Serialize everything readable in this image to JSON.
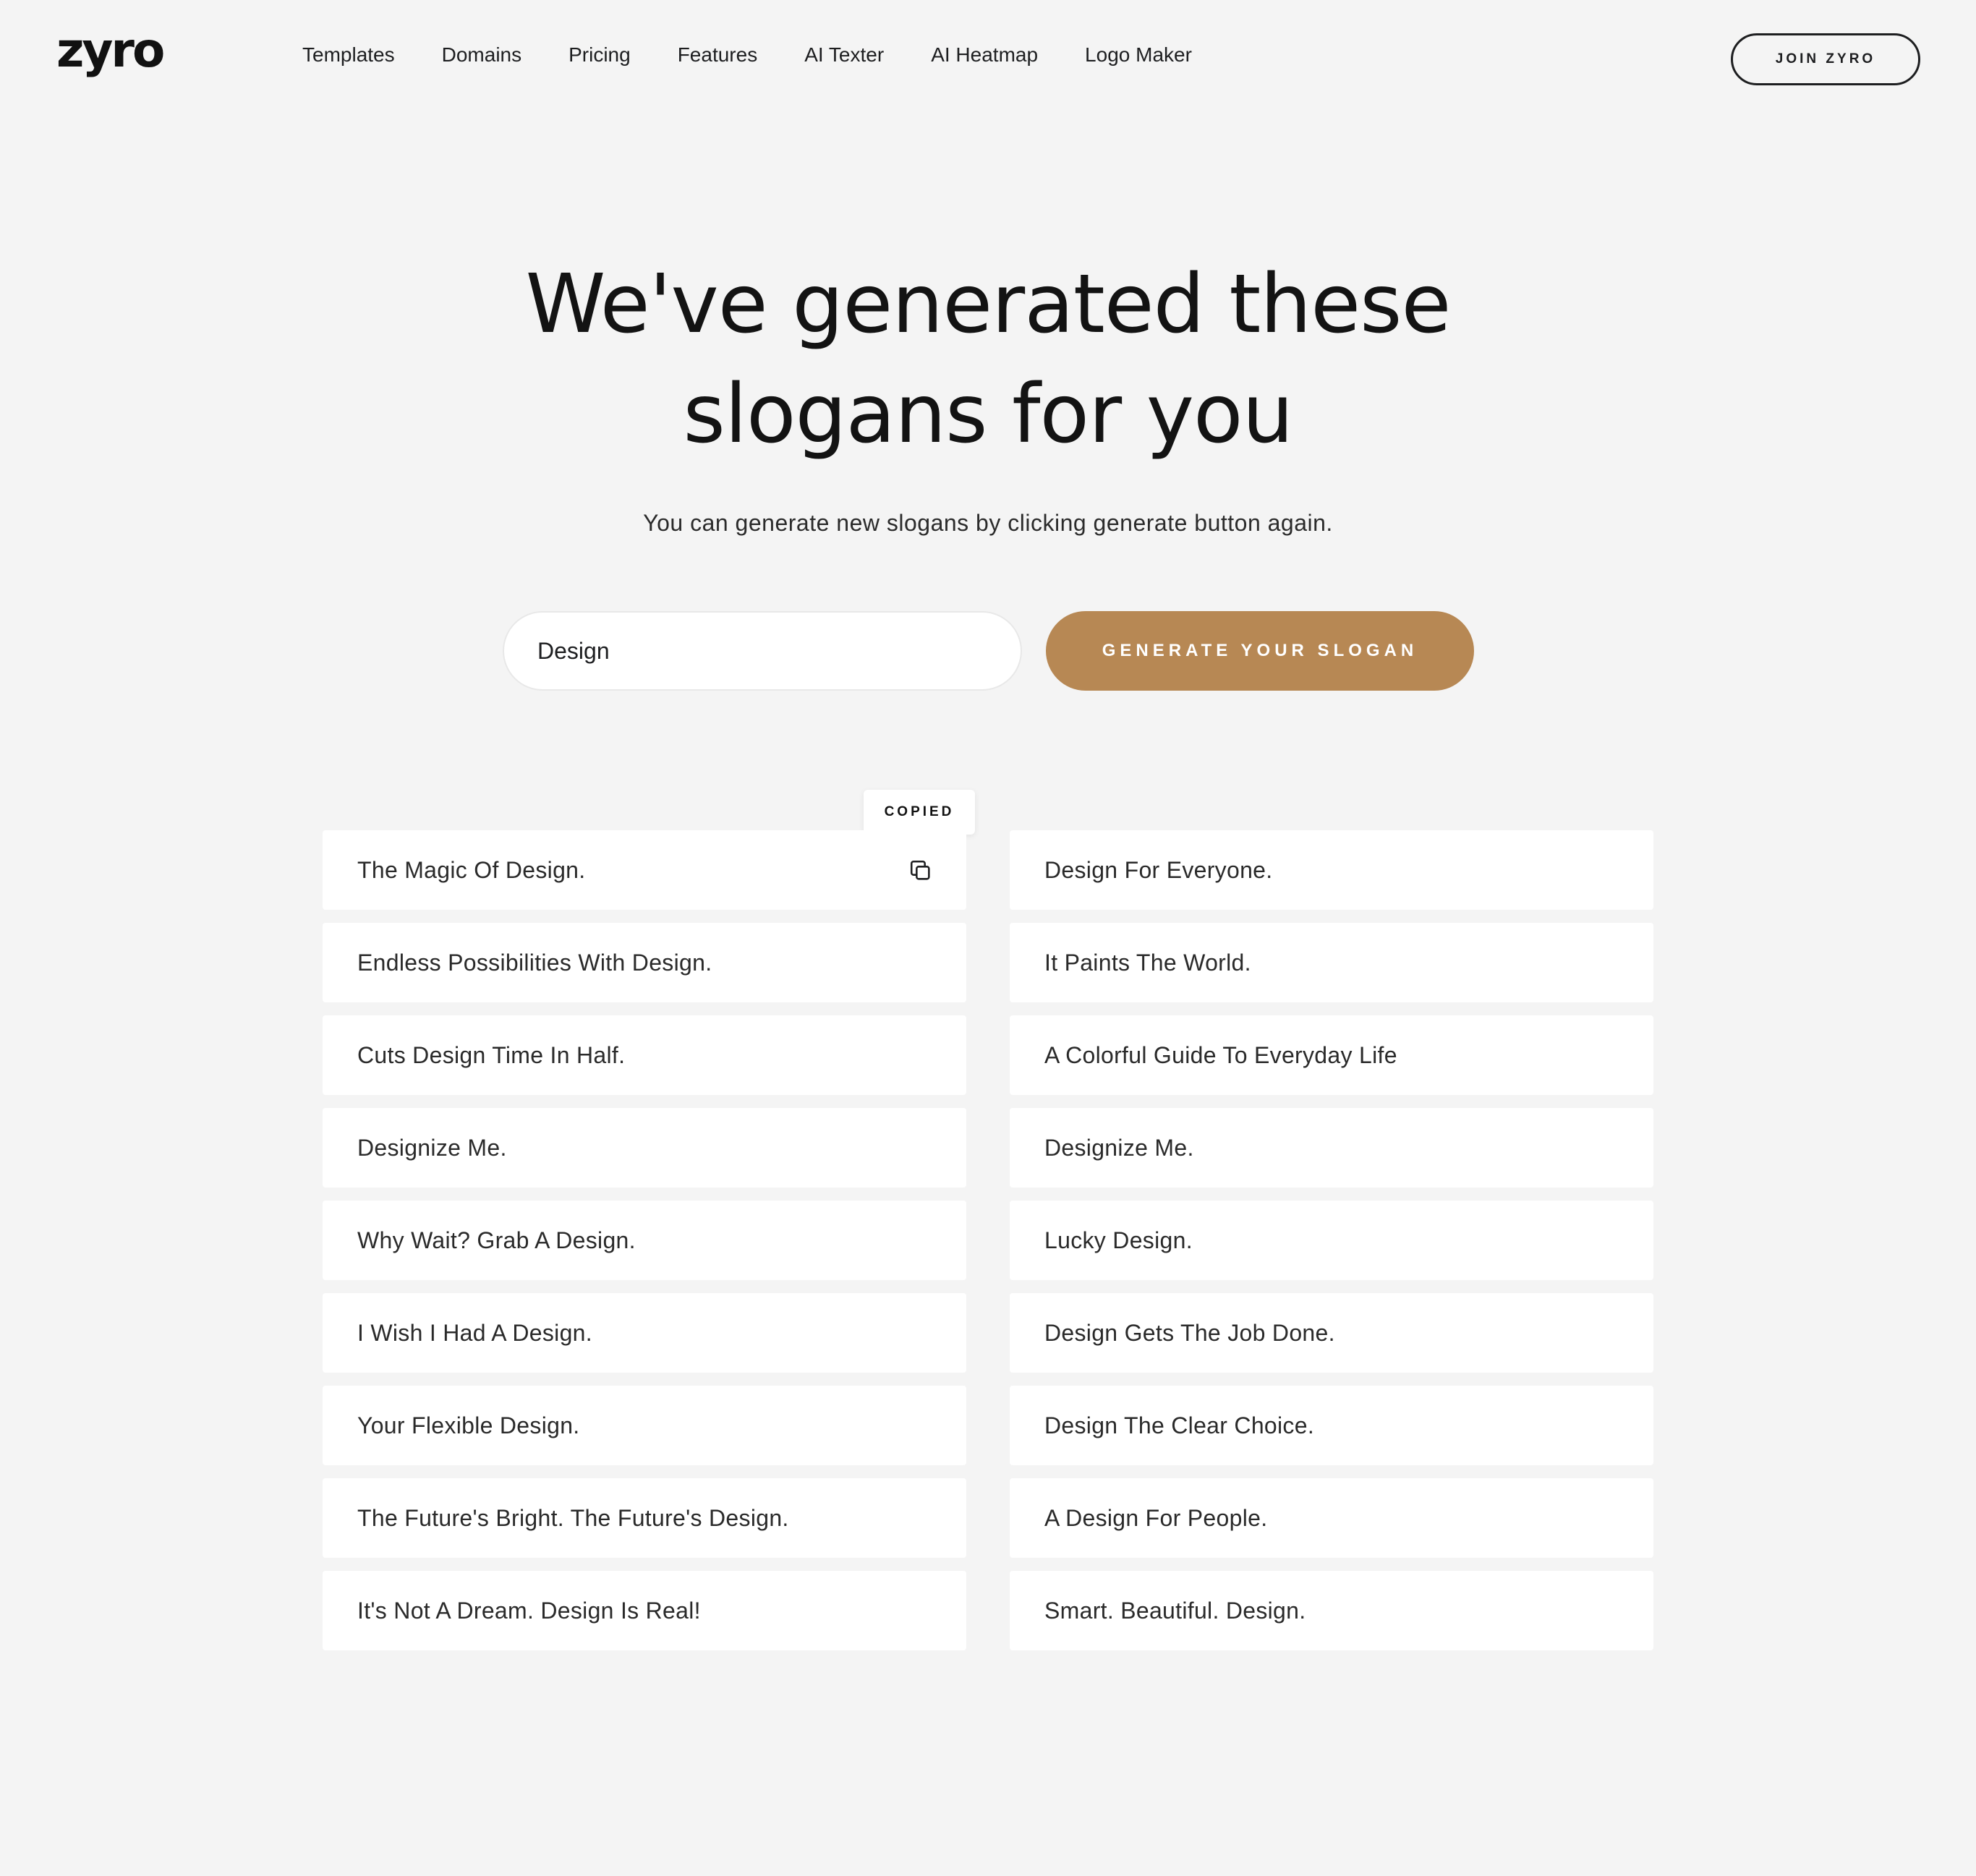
{
  "logo": "zyro",
  "nav": [
    "Templates",
    "Domains",
    "Pricing",
    "Features",
    "AI Texter",
    "AI Heatmap",
    "Logo Maker"
  ],
  "join_label": "JOIN ZYRO",
  "hero": {
    "title_line1": "We've generated these",
    "title_line2": "slogans for you",
    "subtitle": "You can generate new slogans by clicking generate button again."
  },
  "search": {
    "value": "Design"
  },
  "generate_label": "GENERATE YOUR SLOGAN",
  "tooltip": "COPIED",
  "slogans_left": [
    "The Magic Of Design.",
    "Endless Possibilities With Design.",
    "Cuts Design Time In Half.",
    "Designize Me.",
    "Why Wait? Grab A Design.",
    "I Wish I Had A Design.",
    "Your Flexible Design.",
    "The Future's Bright. The Future's Design.",
    "It's Not A Dream. Design Is Real!"
  ],
  "slogans_right": [
    "Design For Everyone.",
    "It Paints The World.",
    "A Colorful Guide To Everyday Life",
    "Designize Me.",
    "Lucky Design.",
    "Design Gets The Job Done.",
    "Design The Clear Choice.",
    "A Design For People.",
    "Smart. Beautiful. Design."
  ],
  "colors": {
    "accent": "#b78854",
    "background": "#f4f4f4"
  },
  "icons": {
    "copy": "copy-icon"
  }
}
